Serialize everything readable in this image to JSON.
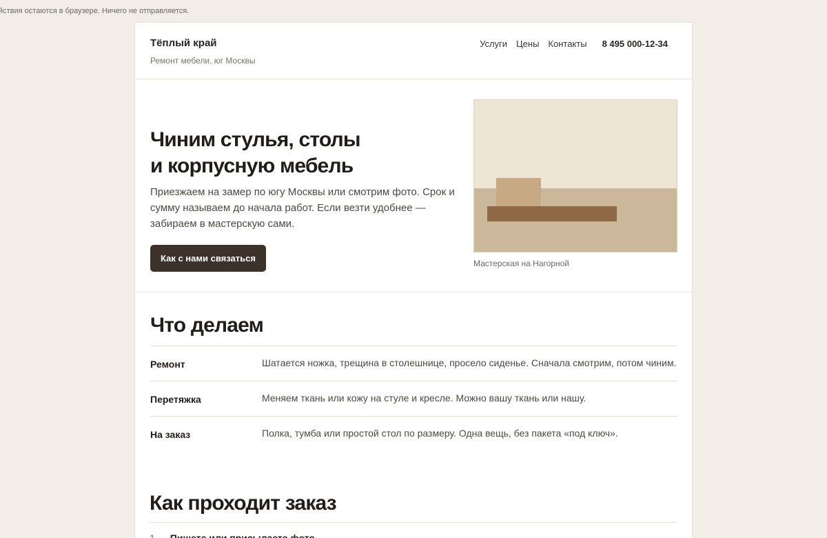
{
  "notice": "йствия остаются в браузере. Ничего не отправляется.",
  "header": {
    "brand": "Тёплый край",
    "tagline": "Ремонт мебели, юг Москвы",
    "nav": [
      "Услуги",
      "Цены",
      "Контакты"
    ],
    "phone": "8 495 000-12-34"
  },
  "hero": {
    "title_line1": "Чиним стулья, столы",
    "title_line2": "и корпусную мебель",
    "text": "Приезжаем на замер по югу Москвы или смотрим фото. Срок и сумму называем до начала работ. Если везти удобнее — забираем в мастерскую сами.",
    "cta": "Как с нами связаться",
    "caption": "Мастерская на Нагорной"
  },
  "services": {
    "title": "Что делаем",
    "items": [
      {
        "name": "Ремонт",
        "desc": "Шатается ножка, трещина в столешнице, просело сиденье. Сначала смотрим, потом чиним."
      },
      {
        "name": "Перетяжка",
        "desc": "Меняем ткань или кожу на стуле и кресле. Можно вашу ткань или нашу."
      },
      {
        "name": "На заказ",
        "desc": "Полка, тумба или простой стол по размеру. Одна вещь, без пакета «под ключ»."
      }
    ]
  },
  "order": {
    "title": "Как проходит заказ",
    "steps": [
      {
        "num": "1",
        "text": "Пишете или присылаете фото"
      }
    ]
  },
  "colors": {
    "background": "#f2ede6",
    "button": "#3d3229",
    "text": "#231d19"
  }
}
